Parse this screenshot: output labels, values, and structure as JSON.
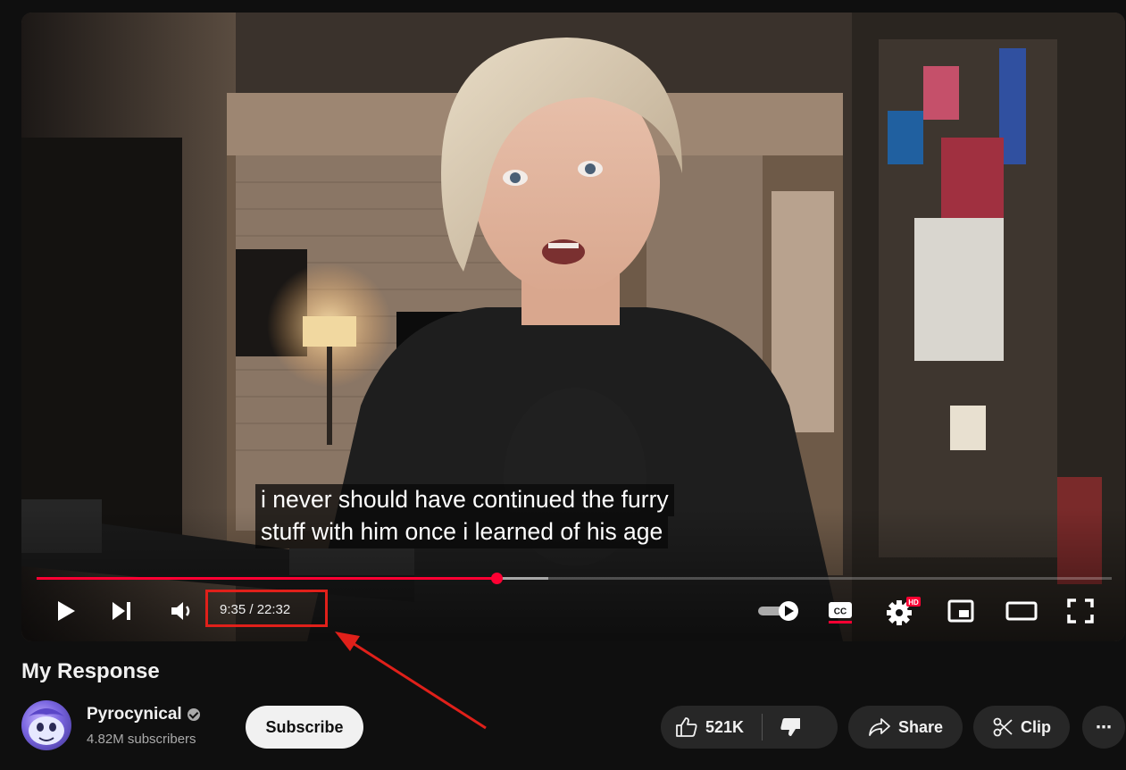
{
  "player": {
    "caption_lines": [
      "i never should have continued the furry",
      "stuff with him once i learned of his age"
    ],
    "time": "9:35 / 22:32",
    "progress_played_fraction": 0.428,
    "progress_buffered_fraction": 0.476,
    "settings_badge": "HD",
    "icons": {
      "play": "play-icon",
      "next": "next-icon",
      "volume": "volume-icon",
      "autoplay": "autoplay-toggle-icon",
      "captions": "captions-icon",
      "settings": "gear-icon",
      "miniplayer": "miniplayer-icon",
      "theater": "theater-mode-icon",
      "fullscreen": "fullscreen-icon"
    }
  },
  "video": {
    "title": "My Response"
  },
  "channel": {
    "name": "Pyrocynical",
    "subscribers": "4.82M subscribers",
    "subscribe_label": "Subscribe"
  },
  "actions": {
    "likes": "521K",
    "share_label": "Share",
    "clip_label": "Clip",
    "more_label": "⋯"
  },
  "colors": {
    "accent": "#ff0033",
    "annotation": "#e0201a",
    "background": "#0f0f0f",
    "pill": "#272727"
  }
}
